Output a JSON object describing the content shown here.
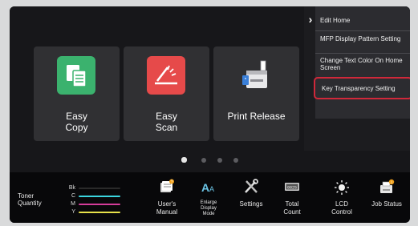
{
  "colors": {
    "accent_highlight": "#d0283a",
    "tile_bg": "#303033",
    "copy_icon": "#3bb26e",
    "scan_icon": "#e64a4a",
    "toner_bk": "#111111",
    "toner_c": "#3bd6e0",
    "toner_m": "#d43c9a",
    "toner_y": "#e8e24a"
  },
  "tiles": [
    {
      "label": "Easy\nCopy",
      "icon": "copy-icon"
    },
    {
      "label": "Easy\nScan",
      "icon": "scan-icon"
    },
    {
      "label": "Print Release",
      "icon": "printer-icon"
    }
  ],
  "pager": {
    "pages": 4,
    "active": 1
  },
  "menu": {
    "toggle": "›",
    "items": [
      "Edit Home",
      "MFP Display Pattern Setting",
      "Change Text Color On Home Screen",
      "Key Transparency Setting"
    ],
    "selected": 4
  },
  "toner": {
    "label": "Toner\nQuantity",
    "channels": [
      "Bk",
      "C",
      "M",
      "Y"
    ]
  },
  "bottom": [
    {
      "label": "User's\nManual",
      "icon": "manual-icon"
    },
    {
      "label": "Enlarge\nDisplay\nMode",
      "icon": "enlarge-text-icon"
    },
    {
      "label": "Settings",
      "icon": "settings-tools-icon"
    },
    {
      "label": "Total\nCount",
      "icon": "counter-icon"
    },
    {
      "label": "LCD\nControl",
      "icon": "brightness-icon"
    },
    {
      "label": "Job Status",
      "icon": "job-status-icon"
    }
  ]
}
